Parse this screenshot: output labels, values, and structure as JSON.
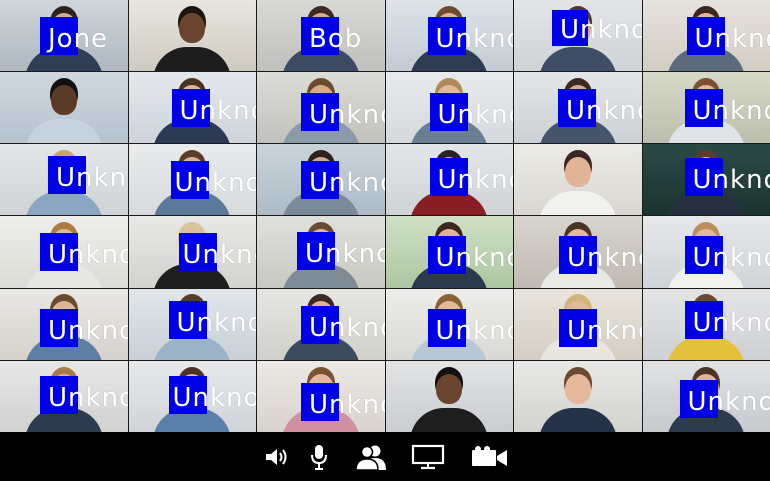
{
  "participants": [
    "Jone",
    "",
    "Bob",
    "Unknown",
    "Unknown",
    "Unknown",
    "",
    "Unknown",
    "Unknown",
    "Unknown",
    "Unknown",
    "Unknown",
    "Unknown",
    "Unknown",
    "Unknown",
    "Unknown",
    "",
    "Unknown",
    "Unknown",
    "Unknown",
    "Unknown",
    "Unknown",
    "Unknown",
    "Unknown",
    "Unknown",
    "Unknown",
    "Unknown",
    "Unknown",
    "Unknown",
    "Unknown",
    "Unknown",
    "Unknown",
    "Unknown",
    "",
    "",
    "Unknown"
  ],
  "face_box_color": "#0000e6",
  "toolbar": {
    "icons": [
      "speaker-icon",
      "microphone-icon",
      "participants-icon",
      "screen-share-icon",
      "video-camera-icon"
    ]
  }
}
